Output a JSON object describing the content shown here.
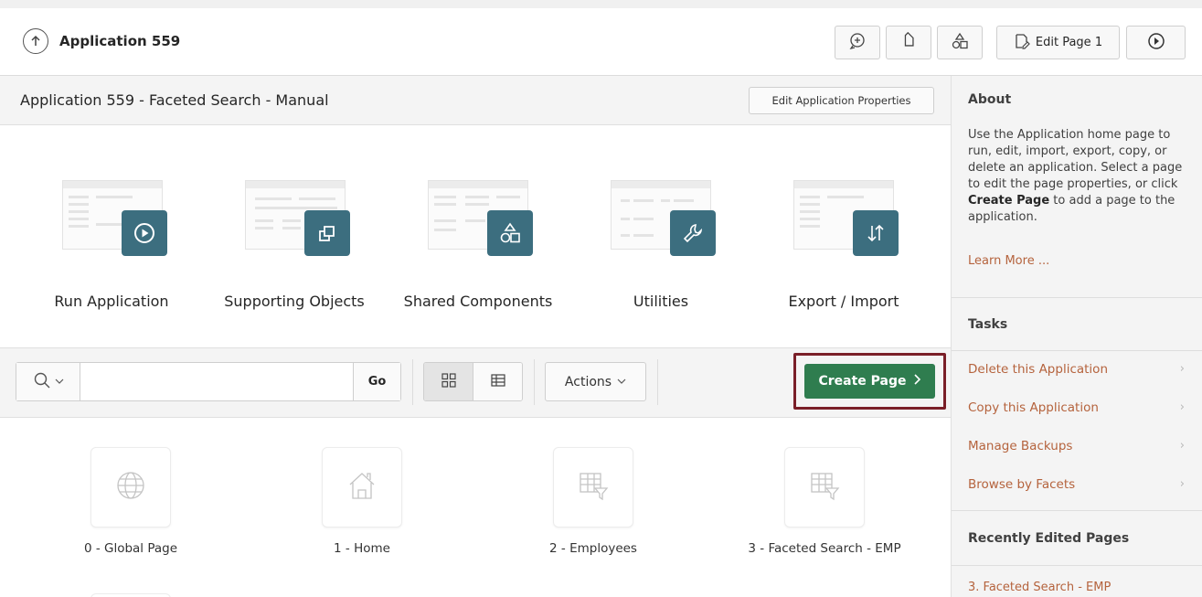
{
  "topbar": {
    "app_title": "Application 559",
    "edit_page_label": "Edit Page 1"
  },
  "main": {
    "title": "Application 559 - Faceted Search - Manual",
    "edit_props_label": "Edit Application Properties"
  },
  "big_icons": [
    {
      "label": "Run Application"
    },
    {
      "label": "Supporting Objects"
    },
    {
      "label": "Shared Components"
    },
    {
      "label": "Utilities"
    },
    {
      "label": "Export / Import"
    }
  ],
  "toolbar": {
    "search_value": "",
    "search_placeholder": "",
    "go_label": "Go",
    "actions_label": "Actions",
    "create_page_label": "Create Page"
  },
  "pages": [
    {
      "label": "0 - Global Page",
      "icon": "globe-icon"
    },
    {
      "label": "1 - Home",
      "icon": "home-icon"
    },
    {
      "label": "2 - Employees",
      "icon": "table-filter-icon"
    },
    {
      "label": "3 - Faceted Search - EMP",
      "icon": "table-filter-icon"
    }
  ],
  "sidebar": {
    "about_heading": "About",
    "about_text_1": "Use the Application home page to run, edit, import, export, copy, or delete an application. Select a page to edit the page properties, or click ",
    "about_text_bold": "Create Page",
    "about_text_2": " to add a page to the application.",
    "learn_more": "Learn More ...",
    "tasks_heading": "Tasks",
    "tasks": [
      {
        "label": "Delete this Application"
      },
      {
        "label": "Copy this Application"
      },
      {
        "label": "Manage Backups"
      },
      {
        "label": "Browse by Facets"
      }
    ],
    "recent_heading": "Recently Edited Pages",
    "recent_items": [
      {
        "label": "3. Faceted Search - EMP"
      }
    ]
  },
  "colors": {
    "badge": "#3c6e7f",
    "create_button": "#2f7d4f",
    "highlight_border": "#7a1f28",
    "link": "#b5633d"
  }
}
